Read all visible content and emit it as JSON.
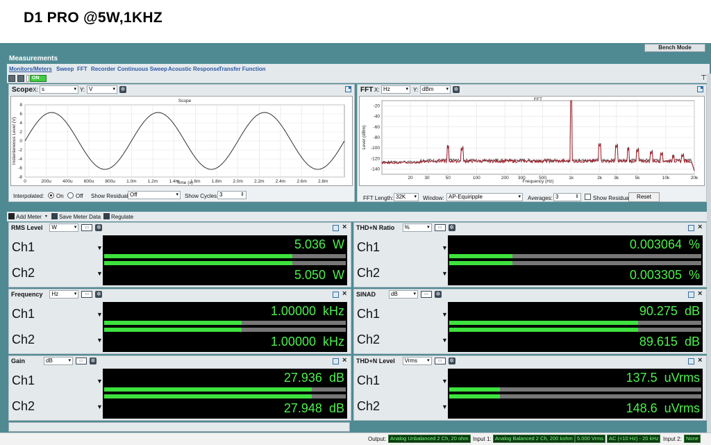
{
  "banner": {
    "title": "D1 PRO @5W,1KHZ"
  },
  "app": {
    "bench_mode": "Bench Mode",
    "measurements_title": "Measurements",
    "tabs": [
      "Monitors/Meters",
      "Sweep",
      "FFT",
      "Recorder",
      "Continuous Sweep",
      "Acoustic Response",
      "Transfer Function"
    ],
    "on_label": "ON"
  },
  "scope": {
    "title": "Scope",
    "x_label": "X:",
    "x_unit": "s",
    "y_label": "Y:",
    "y_unit": "V",
    "interpolated_label": "Interpolated:",
    "on": "On",
    "off": "Off",
    "show_residual_label": "Show Residual:",
    "show_residual_value": "Off",
    "show_cycles_label": "Show Cycles:",
    "show_cycles_value": "3"
  },
  "fft": {
    "title": "FFT",
    "x_label": "X:",
    "x_unit": "Hz",
    "y_label": "Y:",
    "y_unit": "dBm",
    "fft_length_label": "FFT Length:",
    "fft_length_value": "32K",
    "window_label": "Window:",
    "window_value": "AP-Equiripple",
    "averages_label": "Averages:",
    "averages_value": "3",
    "show_residual": "Show Residual",
    "reset": "Reset"
  },
  "meter_toolbar": {
    "add_meter": "Add Meter",
    "save_meter_data": "Save Meter Data",
    "regulate": "Regulate"
  },
  "meters": [
    {
      "title": "RMS Level",
      "unit": "W",
      "ch1_label": "Ch1",
      "ch2_label": "Ch2",
      "ch1_value": "5.036",
      "ch1_unit": "W",
      "ch2_value": "5.050",
      "ch2_unit": "W",
      "ch1_level": 0.78,
      "ch2_level": 0.78
    },
    {
      "title": "THD+N Ratio",
      "unit": "%",
      "ch1_label": "Ch1",
      "ch2_label": "Ch2",
      "ch1_value": "0.003064",
      "ch1_unit": "%",
      "ch2_value": "0.003305",
      "ch2_unit": "%",
      "ch1_level": 0.25,
      "ch2_level": 0.25
    },
    {
      "title": "Frequency",
      "unit": "Hz",
      "ch1_label": "Ch1",
      "ch2_label": "Ch2",
      "ch1_value": "1.00000",
      "ch1_unit": "kHz",
      "ch2_value": "1.00000",
      "ch2_unit": "kHz",
      "ch1_level": 0.57,
      "ch2_level": 0.57
    },
    {
      "title": "SINAD",
      "unit": "dB",
      "ch1_label": "Ch1",
      "ch2_label": "Ch2",
      "ch1_value": "90.275",
      "ch1_unit": "dB",
      "ch2_value": "89.615",
      "ch2_unit": "dB",
      "ch1_level": 0.75,
      "ch2_level": 0.75
    },
    {
      "title": "Gain",
      "unit": "dB",
      "ch1_label": "Ch1",
      "ch2_label": "Ch2",
      "ch1_value": "27.936",
      "ch1_unit": "dB",
      "ch2_value": "27.948",
      "ch2_unit": "dB",
      "ch1_level": 0.86,
      "ch2_level": 0.86
    },
    {
      "title": "THD+N Level",
      "unit": "Vrms",
      "ch1_label": "Ch1",
      "ch2_label": "Ch2",
      "ch1_value": "137.5",
      "ch1_unit": "uVrms",
      "ch2_value": "148.6",
      "ch2_unit": "uVrms",
      "ch1_level": 0.2,
      "ch2_level": 0.2
    }
  ],
  "status": {
    "output_label": "Output:",
    "output_value": "Analog Unbalanced 2 Ch, 20 ohm",
    "input1_label": "Input 1:",
    "input1_value": "Analog Balanced 2 Ch, 200 kohm",
    "input1_range": "5.000 Vrms",
    "input1_filter": "AC (<10 Hz) - 20 kHz",
    "input2_label": "Input 2:",
    "input2_value": "None"
  },
  "chart_data": [
    {
      "type": "line",
      "title": "Scope",
      "xlabel": "Time (s)",
      "ylabel": "Instantaneous Level (V)",
      "x_ticks": [
        "0",
        "200u",
        "400u",
        "600u",
        "800u",
        "1.0m",
        "1.2m",
        "1.4m",
        "1.6m",
        "1.8m",
        "2.0m",
        "2.2m",
        "2.4m",
        "2.6m",
        "2.8m"
      ],
      "y_ticks": [
        "8",
        "6",
        "4",
        "2",
        "0",
        "-2",
        "-4",
        "-6",
        "-8"
      ],
      "xlim": [
        0,
        0.003
      ],
      "ylim": [
        -8,
        8
      ],
      "series": [
        {
          "frequency_hz": 1000,
          "amplitude_v": 6.3,
          "phase_deg": 0
        }
      ],
      "grid": true
    },
    {
      "type": "line",
      "title": "FFT",
      "xlabel": "Frequency (Hz)",
      "ylabel": "Level (dBm)",
      "x_ticks": [
        "20",
        "30",
        "50",
        "100",
        "200",
        "300",
        "500",
        "1k",
        "2k",
        "3k",
        "5k",
        "10k",
        "20k"
      ],
      "y_ticks": [
        "-20",
        "-40",
        "-60",
        "-80",
        "-100",
        "-120",
        "-140"
      ],
      "x_scale": "log",
      "xlim": [
        10,
        20000
      ],
      "ylim": [
        -150,
        -10
      ],
      "noise_floor_dbm": -125,
      "peaks": [
        {
          "x": 50,
          "y": -100
        },
        {
          "x": 70,
          "y": -105
        },
        {
          "x": 1000,
          "y": -10
        },
        {
          "x": 2000,
          "y": -98
        },
        {
          "x": 3000,
          "y": -100
        },
        {
          "x": 4000,
          "y": -104
        },
        {
          "x": 5000,
          "y": -108
        },
        {
          "x": 7000,
          "y": -112
        },
        {
          "x": 9000,
          "y": -115
        },
        {
          "x": 12000,
          "y": -118
        },
        {
          "x": 15000,
          "y": -118
        }
      ],
      "colors": {
        "ch1": "#a0202a",
        "ch2": "#3a3a3a"
      },
      "grid": true
    }
  ]
}
